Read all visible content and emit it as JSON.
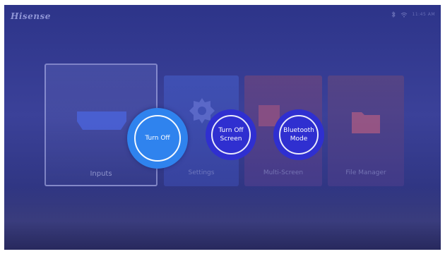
{
  "brand": "Hisense",
  "status": {
    "time": "11:45 AM"
  },
  "tiles": [
    {
      "label": "Inputs"
    },
    {
      "label": "Settings"
    },
    {
      "label": "Multi-Screen"
    },
    {
      "label": "File Manager"
    }
  ],
  "power_menu": {
    "turn_off": "Turn Off",
    "screen_line1": "Turn Off",
    "screen_line2": "Screen",
    "bt_line1": "Bluetooth",
    "bt_line2": "Mode"
  },
  "colors": {
    "overlay": "#2d3489",
    "focused_button": "#2f83ee",
    "button": "#2f2fd0"
  },
  "icons": [
    "bluetooth-icon",
    "wifi-icon",
    "hdmi-input-icon",
    "gear-icon",
    "multi-screen-icon",
    "folder-icon"
  ]
}
